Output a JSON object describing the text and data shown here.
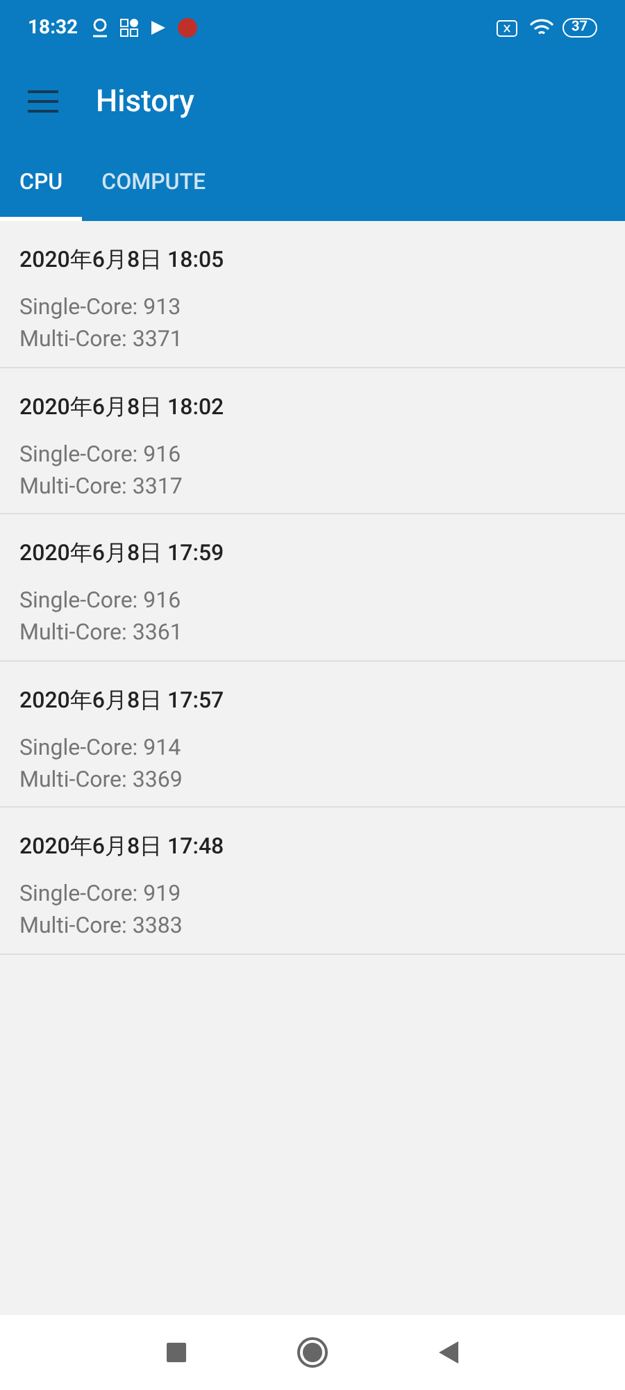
{
  "status_bar": {
    "time": "18:32",
    "battery": "37"
  },
  "toolbar": {
    "title": "History"
  },
  "tabs": [
    {
      "label": "CPU",
      "selected": true
    },
    {
      "label": "COMPUTE",
      "selected": false
    }
  ],
  "results": [
    {
      "date": "2020年6月8日 18:05",
      "single": "Single-Core: 913",
      "multi": "Multi-Core: 3371"
    },
    {
      "date": "2020年6月8日 18:02",
      "single": "Single-Core: 916",
      "multi": "Multi-Core: 3317"
    },
    {
      "date": "2020年6月8日 17:59",
      "single": "Single-Core: 916",
      "multi": "Multi-Core: 3361"
    },
    {
      "date": "2020年6月8日 17:57",
      "single": "Single-Core: 914",
      "multi": "Multi-Core: 3369"
    },
    {
      "date": "2020年6月8日 17:48",
      "single": "Single-Core: 919",
      "multi": "Multi-Core: 3383"
    }
  ]
}
